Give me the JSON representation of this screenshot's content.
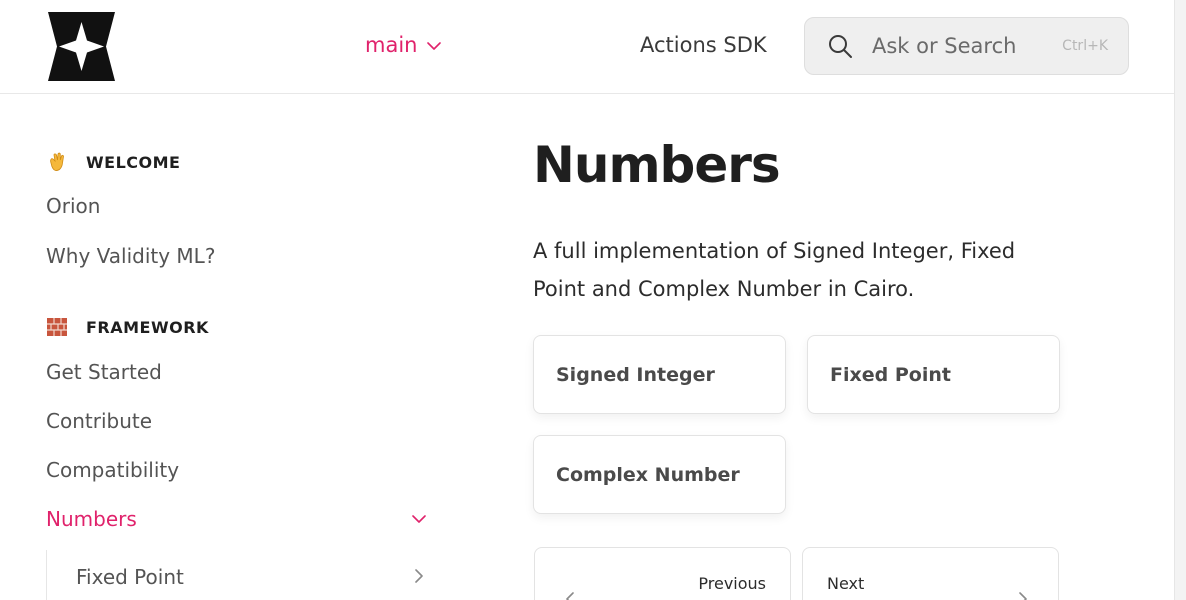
{
  "header": {
    "logo_name": "logo-icon",
    "version": {
      "label": "main"
    },
    "nav_link": "Actions SDK",
    "search": {
      "placeholder": "Ask or Search",
      "shortcut": "Ctrl+K"
    }
  },
  "sidebar": {
    "sections": [
      {
        "emoji": "waving-hand-icon",
        "title": "WELCOME",
        "items": [
          "Orion",
          "Why Validity ML?"
        ]
      },
      {
        "emoji": "bricks-icon",
        "title": "FRAMEWORK",
        "items": [
          "Get Started",
          "Contribute",
          "Compatibility",
          "Numbers"
        ]
      }
    ],
    "active_item": "Numbers",
    "sub_items": [
      "Fixed Point"
    ]
  },
  "main": {
    "title": "Numbers",
    "description": "A full implementation of Signed Integer, Fixed Point and Complex Number in Cairo.",
    "cards": [
      "Signed Integer",
      "Fixed Point",
      "Complex Number"
    ],
    "pager": {
      "previous": "Previous",
      "next": "Next"
    }
  },
  "colors": {
    "accent": "#e0226b",
    "text": "#1f1f1f",
    "muted": "#545454",
    "border": "#e3e3e3",
    "search_bg": "#efefef"
  }
}
